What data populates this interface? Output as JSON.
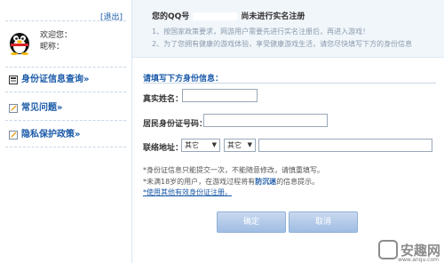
{
  "sidebar": {
    "logout": "[退出]",
    "welcome": "欢迎您：",
    "nickname_label": "昵称：",
    "nav": [
      {
        "label": "身份证信息查询»",
        "icon": "id-card-icon"
      },
      {
        "label": "常见问题»",
        "icon": "pencil-icon"
      },
      {
        "label": "隐私保护政策»",
        "icon": "pencil-icon"
      }
    ]
  },
  "notice": {
    "prefix": "您的QQ号",
    "suffix": "尚未进行实名注册",
    "line1": "1、按国家政策要求，网游用户需要先进行实名注册后，再进入游戏！",
    "line2": "2、为了您拥有健康的游戏体验，享受健康游戏生活，请您尽快填写下方的身份信息"
  },
  "form": {
    "title": "请填写下方身份信息：",
    "name_label": "真实姓名：",
    "id_label": "居民身份证号码：",
    "address_label": "联络地址：",
    "select1": "其它",
    "select2": "其它"
  },
  "notes": {
    "n1": "*身份证信息只能提交一次，不能随意修改，请慎重填写。",
    "n2_pre": "*未满18岁的用户，在游戏过程将有",
    "n2_link": "防沉迷",
    "n2_post": "的信息提示。",
    "n3": "*使用其他有效身份证注册。"
  },
  "buttons": {
    "confirm": "确定",
    "cancel": "取消"
  },
  "watermark": {
    "brand": "安趣网",
    "site": "www.anqu.com"
  },
  "colors": {
    "link": "#1a5aa8",
    "accent": "#9fbde3"
  }
}
